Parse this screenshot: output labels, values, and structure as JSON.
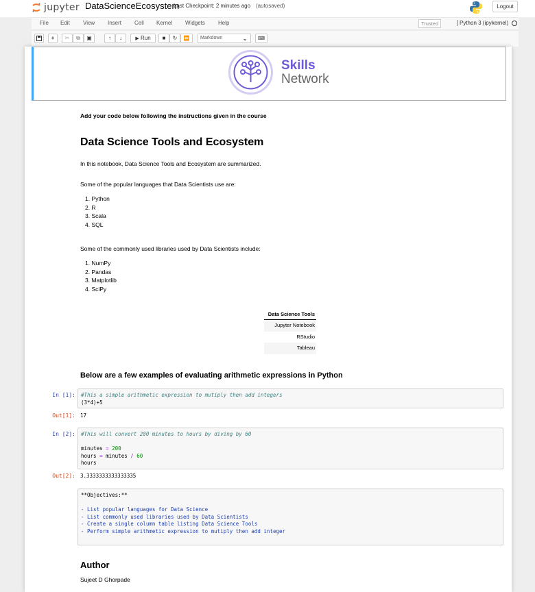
{
  "header": {
    "logo_text": "jupyter",
    "notebook_name": "DataScienceEcosystem",
    "checkpoint": "Last Checkpoint: 2 minutes ago",
    "autosave": "(autosaved)",
    "logout_label": "Logout"
  },
  "menubar": {
    "items": [
      "File",
      "Edit",
      "View",
      "Insert",
      "Cell",
      "Kernel",
      "Widgets",
      "Help"
    ],
    "trusted": "Trusted",
    "kernel": "Python 3 (ipykernel)"
  },
  "toolbar": {
    "run_label": "Run",
    "cell_type": "Markdown"
  },
  "banner": {
    "brand_line1": "Skills",
    "brand_line2": "Network"
  },
  "notebook": {
    "intro_note": "Add your code below following the instructions given in the course",
    "title": "Data Science Tools and Ecosystem",
    "summary": "In this notebook, Data Science Tools and Ecosystem are summarized.",
    "languages_intro": "Some of the popular languages that Data Scientists use are:",
    "languages": [
      "1. Python",
      "2. R",
      "3. Scala",
      "4. SQL"
    ],
    "libraries_intro": "Some of the commonly used libraries used by Data Scientists include:",
    "libraries": [
      "1. NumPy",
      "2. Pandas",
      "3. Matplotlib",
      "4. SciPy"
    ],
    "table": {
      "header": "Data Science Tools",
      "rows": [
        "Jupyter Notebook",
        "RStudio",
        "Tableau"
      ]
    },
    "examples_heading": "Below are a few examples of evaluating arithmetic expressions in Python",
    "cell1": {
      "in_prompt": "In [1]:",
      "comment": "#This a simple arithmetic expression to mutiply then add integers",
      "code_line2": "(3*4)+5",
      "out_prompt": "Out[1]:",
      "output": "17"
    },
    "cell2": {
      "in_prompt": "In [2]:",
      "comment": "#This will convert 200 minutes to hours by diving by 60",
      "line_minutes_var": "minutes",
      "line_minutes_op": " = ",
      "line_minutes_val": "200",
      "line_hours_var": "hours",
      "line_hours_eq": " = ",
      "line_hours_mid": "minutes",
      "line_hours_op": " / ",
      "line_hours_val": "60",
      "line_result": "hours",
      "out_prompt": "Out[2]:",
      "output": "3.3333333333333335"
    },
    "objectives": {
      "title": "**Objectives:**",
      "items": [
        "- List popular languages for Data Science",
        "- List commonly used libraries used by Data Scientists",
        "- Create a single column table listing Data Science Tools",
        "- Perform simple arithmetic expression to mutiply then add integer"
      ]
    },
    "author_heading": "Author",
    "author_name": "Sujeet D Ghorpade"
  },
  "icons": [
    "jupyter-logo-icon",
    "python-logo-icon",
    "save-icon",
    "add-cell-icon",
    "cut-icon",
    "copy-icon",
    "paste-icon",
    "move-up-icon",
    "move-down-icon",
    "run-icon",
    "stop-icon",
    "restart-icon",
    "fast-forward-icon",
    "keyboard-icon",
    "kernel-idle-icon"
  ],
  "colors": {
    "selected_cell_border": "#42a5f5",
    "in_prompt": "#303f9f",
    "out_prompt": "#d84315",
    "brand_purple": "#6f5bd6"
  }
}
